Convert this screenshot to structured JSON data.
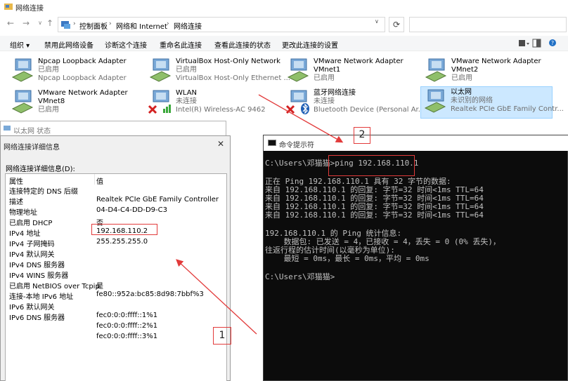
{
  "window": {
    "title": "网络连接"
  },
  "nav": {
    "back": "←",
    "forward": "→",
    "dropdown": "∨",
    "up": "↑"
  },
  "breadcrumb": {
    "items": [
      "控制面板",
      "网络和 Internet",
      "网络连接"
    ],
    "sep": "›"
  },
  "search": {
    "placeholder": ""
  },
  "toolbar": {
    "organize": "组织 ▾",
    "disable": "禁用此网络设备",
    "diagnose": "诊断这个连接",
    "rename": "重命名此连接",
    "view_status": "查看此连接的状态",
    "change_settings": "更改此连接的设置"
  },
  "adapters": [
    {
      "name": "Npcap Loopback Adapter",
      "line2": "已启用",
      "line3": "Npcap Loopback Adapter"
    },
    {
      "name": "VirtualBox Host-Only Network",
      "line2": "已启用",
      "line3": "VirtualBox Host-Only Ethernet ..."
    },
    {
      "name": "VMware Network Adapter",
      "name2": "VMnet1",
      "line3": "已启用"
    },
    {
      "name": "VMware Network Adapter",
      "name2": "VMnet2",
      "line3": "已启用"
    },
    {
      "name": "VMware Network Adapter",
      "name2": "VMnet8",
      "line3": "已启用"
    },
    {
      "name": "WLAN",
      "line2": "未连接",
      "line3": "Intel(R) Wireless-AC 9462"
    },
    {
      "name": "蓝牙网络连接",
      "line2": "未连接",
      "line3": "Bluetooth Device (Personal Ar..."
    },
    {
      "name": "以太网",
      "line2": "未识别的网络",
      "line3": "Realtek PCIe GbE Family Contr..."
    }
  ],
  "status_window": {
    "title": "以太网 状态"
  },
  "details_window": {
    "title": "网络连接详细信息",
    "label": "网络连接详细信息(D):",
    "headers": {
      "property": "属性",
      "value": "值"
    },
    "rows": [
      {
        "p": "连接特定的 DNS 后缀",
        "v": ""
      },
      {
        "p": "描述",
        "v": "Realtek PCIe GbE Family Controller"
      },
      {
        "p": "物理地址",
        "v": "04-D4-C4-DD-D9-C3"
      },
      {
        "p": "已启用 DHCP",
        "v": "否"
      },
      {
        "p": "IPv4 地址",
        "v": "192.168.110.2"
      },
      {
        "p": "IPv4 子网掩码",
        "v": "255.255.255.0"
      },
      {
        "p": "IPv4 默认网关",
        "v": ""
      },
      {
        "p": "IPv4 DNS 服务器",
        "v": ""
      },
      {
        "p": "IPv4 WINS 服务器",
        "v": ""
      },
      {
        "p": "已启用 NetBIOS over Tcpip",
        "v": "是"
      },
      {
        "p": "连接-本地 IPv6 地址",
        "v": "fe80::952a:bc85:8d98:7bbf%3"
      },
      {
        "p": "IPv6 默认网关",
        "v": ""
      },
      {
        "p": "IPv6 DNS 服务器",
        "v": "fec0:0:0:ffff::1%1"
      },
      {
        "p": "",
        "v": "fec0:0:0:ffff::2%1"
      },
      {
        "p": "",
        "v": "fec0:0:0:ffff::3%1"
      }
    ]
  },
  "cmd": {
    "title": "命令提示符",
    "lines": [
      "C:\\Users\\邓猫猫>ping 192.168.110.1",
      "",
      "正在 Ping 192.168.110.1 具有 32 字节的数据:",
      "来自 192.168.110.1 的回复: 字节=32 时间<1ms TTL=64",
      "来自 192.168.110.1 的回复: 字节=32 时间<1ms TTL=64",
      "来自 192.168.110.1 的回复: 字节=32 时间<1ms TTL=64",
      "来自 192.168.110.1 的回复: 字节=32 时间<1ms TTL=64",
      "",
      "192.168.110.1 的 Ping 统计信息:",
      "    数据包: 已发送 = 4，已接收 = 4，丢失 = 0 (0% 丢失)，",
      "往返行程的估计时间(以毫秒为单位):",
      "    最短 = 0ms，最长 = 0ms，平均 = 0ms",
      "",
      "C:\\Users\\邓猫猫>"
    ]
  },
  "annotations": {
    "marker1": "1",
    "marker2": "2",
    "arrow_color": "#e23b3b"
  },
  "colors": {
    "selected_bg": "#cce8ff",
    "console_bg": "#0c0c0c",
    "console_fg": "#c0c0c0"
  }
}
